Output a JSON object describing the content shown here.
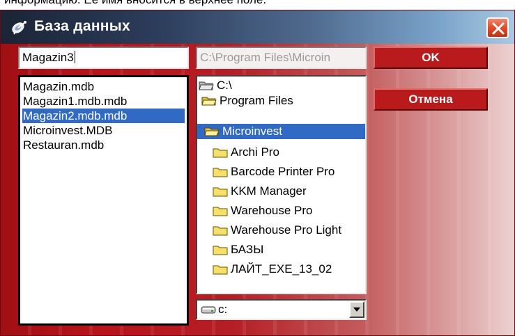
{
  "caption": "информацию. Её имя вносится в верхнее поле.",
  "window": {
    "title": "База данных",
    "title_icon": "satellite-dish-icon",
    "close_icon": "close-icon"
  },
  "name_input": {
    "value": "Magazin3"
  },
  "path_input": {
    "value": "C:\\Program Files\\Microin"
  },
  "buttons": {
    "ok": "OK",
    "cancel": "Отмена"
  },
  "files": [
    {
      "label": "Magazin.mdb",
      "selected": false
    },
    {
      "label": "Magazin1.mdb.mdb",
      "selected": false
    },
    {
      "label": "Magazin2.mdb.mdb",
      "selected": true
    },
    {
      "label": "Microinvest.MDB",
      "selected": false
    },
    {
      "label": "Restauran.mdb",
      "selected": false
    }
  ],
  "directories": [
    {
      "label": "C:\\",
      "icon": "open-folder-icon",
      "selected": false
    },
    {
      "label": "Program Files",
      "icon": "open-folder-icon",
      "selected": false
    },
    {
      "label": "Microinvest",
      "icon": "open-folder-icon",
      "selected": true
    },
    {
      "label": "Archi Pro",
      "icon": "folder-icon",
      "selected": false
    },
    {
      "label": "Barcode Printer Pro",
      "icon": "folder-icon",
      "selected": false
    },
    {
      "label": "KKM Manager",
      "icon": "folder-icon",
      "selected": false
    },
    {
      "label": "Warehouse Pro",
      "icon": "folder-icon",
      "selected": false
    },
    {
      "label": "Warehouse Pro Light",
      "icon": "folder-icon",
      "selected": false
    },
    {
      "label": "БАЗЫ",
      "icon": "folder-icon",
      "selected": false
    },
    {
      "label": "ЛАЙТ_EXE_13_02",
      "icon": "folder-icon",
      "selected": false
    }
  ],
  "drive": {
    "label": "c:",
    "icon": "drive-icon"
  },
  "colors": {
    "accent": "#b91b1d",
    "selection": "#316ac5",
    "title_start": "#1b2436",
    "title_end": "#a9c8e2"
  }
}
